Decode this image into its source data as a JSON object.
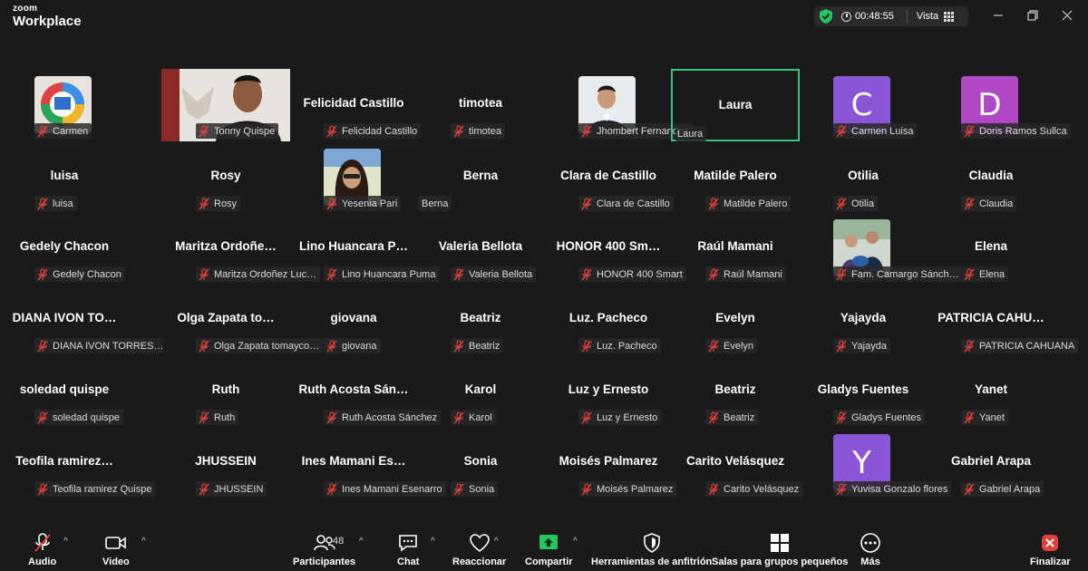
{
  "app": {
    "brand_small": "zoom",
    "brand_large": "Workplace"
  },
  "status": {
    "timer": "00:48:55",
    "view_label": "Vista"
  },
  "colors": {
    "background": "#1a1a1a",
    "active_border": "#3ac37c",
    "muted_red": "#e0403a",
    "share_green": "#22c55e"
  },
  "tiles": [
    {
      "name": "",
      "caption": "Carmen",
      "avatar": "photo-logo"
    },
    {
      "name": "",
      "caption": "Tonny Quispe",
      "avatar": "video"
    },
    {
      "name": "Felicidad Castillo",
      "caption": "Felicidad Castillo"
    },
    {
      "name": "timotea",
      "caption": "timotea"
    },
    {
      "name": "",
      "caption": "Jhombert Fernandez",
      "avatar": "photo-man"
    },
    {
      "name": "Laura",
      "caption": "Laura",
      "active": true
    },
    {
      "name": "",
      "caption": "Carmen Luisa",
      "avatar": "letter",
      "letter": "C",
      "color": "#8a55d6"
    },
    {
      "name": "",
      "caption": "Doris Ramos Sullca",
      "avatar": "letter",
      "letter": "D",
      "color": "#b048c8"
    },
    {
      "name": "luisa",
      "caption": "luisa"
    },
    {
      "name": "Rosy",
      "caption": "Rosy"
    },
    {
      "name": "",
      "caption": "Yesenia Pari",
      "avatar": "photo-woman"
    },
    {
      "name": "Berna",
      "caption": "Berna",
      "nomic": true
    },
    {
      "name": "Clara de Castillo",
      "caption": "Clara de Castillo"
    },
    {
      "name": "Matilde Palero",
      "caption": "Matilde Palero"
    },
    {
      "name": "Otilia",
      "caption": "Otilia"
    },
    {
      "name": "Claudia",
      "caption": "Claudia"
    },
    {
      "name": "Gedely Chacon",
      "caption": "Gedely Chacon"
    },
    {
      "name": "Maritza  Ordoñe…",
      "caption": "Maritza Ordoñez Luc…"
    },
    {
      "name": "Lino  Huancara  P…",
      "caption": "Lino Huancara Puma"
    },
    {
      "name": "Valeria Bellota",
      "caption": "Valeria Bellota"
    },
    {
      "name": "HONOR 400 Sm…",
      "caption": "HONOR 400 Smart"
    },
    {
      "name": "Raúl Mamani",
      "caption": "Raúl Mamani"
    },
    {
      "name": "",
      "caption": "Fam. Camargo Sánch…",
      "avatar": "photo-family"
    },
    {
      "name": "Elena",
      "caption": "Elena"
    },
    {
      "name": "DIANA IVON TO…",
      "caption": "DIANA IVON TORRES…"
    },
    {
      "name": "Olga  Zapata  to…",
      "caption": "Olga Zapata tomayco…"
    },
    {
      "name": "giovana",
      "caption": "giovana"
    },
    {
      "name": "Beatriz",
      "caption": "Beatriz"
    },
    {
      "name": "Luz. Pacheco",
      "caption": "Luz. Pacheco"
    },
    {
      "name": "Evelyn",
      "caption": "Evelyn"
    },
    {
      "name": "Yajayda",
      "caption": "Yajayda"
    },
    {
      "name": "PATRICIA  CAHU…",
      "caption": "PATRICIA CAHUANA"
    },
    {
      "name": "soledad quispe",
      "caption": "soledad quispe"
    },
    {
      "name": "Ruth",
      "caption": "Ruth"
    },
    {
      "name": "Ruth Acosta Sán…",
      "caption": "Ruth Acosta Sánchez"
    },
    {
      "name": "Karol",
      "caption": "Karol"
    },
    {
      "name": "Luz y Ernesto",
      "caption": "Luz y Ernesto"
    },
    {
      "name": "Beatriz",
      "caption": "Beatriz"
    },
    {
      "name": "Gladys Fuentes",
      "caption": "Gladys Fuentes"
    },
    {
      "name": "Yanet",
      "caption": "Yanet"
    },
    {
      "name": "Teofila  ramirez…",
      "caption": "Teofila ramirez Quispe"
    },
    {
      "name": "JHUSSEIN",
      "caption": "JHUSSEIN"
    },
    {
      "name": "Ines  Mamani  Es…",
      "caption": "Ines Mamani Esenarro"
    },
    {
      "name": "Sonia",
      "caption": "Sonia"
    },
    {
      "name": "Moisés Palmarez",
      "caption": "Moisés Palmarez"
    },
    {
      "name": "Carito Velásquez",
      "caption": "Carito Velásquez"
    },
    {
      "name": "",
      "caption": "Yuvisa Gonzalo flores",
      "avatar": "letter",
      "letter": "Y",
      "color": "#8a55d6"
    },
    {
      "name": "Gabriel Arapa",
      "caption": "Gabriel Arapa"
    }
  ],
  "toolbar": {
    "audio": "Audio",
    "video": "Video",
    "participants": "Participantes",
    "participants_count": "48",
    "chat": "Chat",
    "react": "Reaccionar",
    "share": "Compartir",
    "host_tools": "Herramientas de anfitrión",
    "breakout": "Salas para grupos pequeños",
    "more": "Más",
    "end": "Finalizar"
  }
}
